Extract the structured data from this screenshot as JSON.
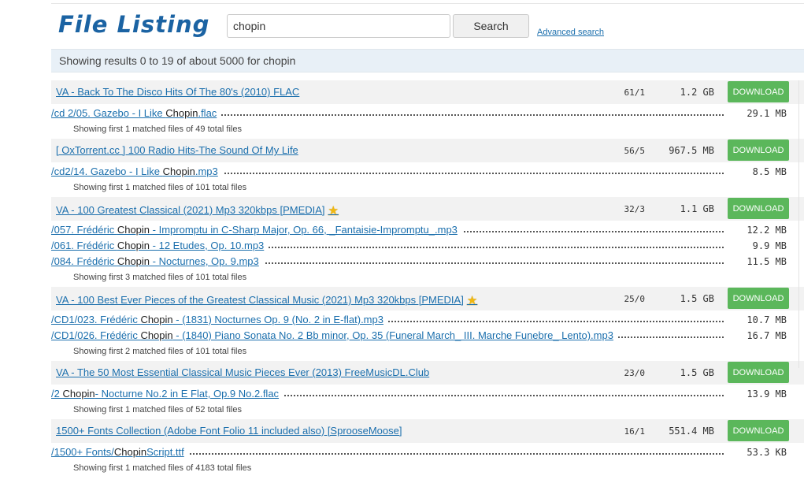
{
  "header": {
    "logo_text": "File Listing",
    "search_value": "chopin",
    "search_button": "Search",
    "advanced_link": "Advanced search"
  },
  "results_text": "Showing results 0 to 19 of about 5000 for chopin",
  "accent_colors": {
    "link": "#1b6fad",
    "download_button": "#5bb75b",
    "logo": "#1b63a3"
  },
  "download_label": "DOWNLOAD",
  "groups": [
    {
      "title": "VA - Back To The Disco Hits Of The 80's (2010) FLAC",
      "starred": false,
      "ratio": "61/1",
      "size": "1.2 GB",
      "files": [
        {
          "pre": "/cd 2/05. Gazebo - I Like ",
          "hl": "Chopin",
          "post": ".flac",
          "size": "29.1 MB"
        }
      ],
      "note": "Showing first 1 matched files of 49 total files"
    },
    {
      "title": "[ OxTorrent.cc ] 100 Radio Hits-The Sound Of My Life",
      "starred": false,
      "ratio": "56/5",
      "size": "967.5 MB",
      "files": [
        {
          "pre": "/cd2/14. Gazebo - I Like ",
          "hl": "Chopin",
          "post": ".mp3",
          "size": "8.5 MB"
        }
      ],
      "note": "Showing first 1 matched files of 101 total files"
    },
    {
      "title": "VA - 100 Greatest Classical (2021) Mp3 320kbps [PMEDIA]",
      "starred": true,
      "ratio": "32/3",
      "size": "1.1 GB",
      "files": [
        {
          "pre": "/057. Frédéric ",
          "hl": "Chopin",
          "post": " - Impromptu in C-Sharp Major, Op. 66, _Fantaisie-Impromptu_.mp3",
          "size": "12.2 MB"
        },
        {
          "pre": "/061. Frédéric ",
          "hl": "Chopin",
          "post": " - 12 Etudes, Op. 10.mp3",
          "size": "9.9 MB"
        },
        {
          "pre": "/084. Frédéric ",
          "hl": "Chopin",
          "post": " - Nocturnes, Op. 9.mp3",
          "size": "11.5 MB"
        }
      ],
      "note": "Showing first 3 matched files of 101 total files"
    },
    {
      "title": "VA - 100 Best Ever Pieces of the Greatest Classical Music (2021) Mp3 320kbps [PMEDIA]",
      "starred": true,
      "ratio": "25/0",
      "size": "1.5 GB",
      "files": [
        {
          "pre": "/CD1/023. Frédéric ",
          "hl": "Chopin",
          "post": " - (1831) Nocturnes Op. 9 (No. 2 in E-flat).mp3",
          "size": "10.7 MB"
        },
        {
          "pre": "/CD1/026. Frédéric ",
          "hl": "Chopin",
          "post": " - (1840) Piano Sonata No. 2 Bb minor, Op. 35 (Funeral March_ III. Marche Funebre_ Lento).mp3",
          "size": "16.7 MB"
        }
      ],
      "note": "Showing first 2 matched files of 101 total files"
    },
    {
      "title": "VA - The 50 Most Essential Classical Music Pieces Ever (2013) FreeMusicDL.Club",
      "starred": false,
      "ratio": "23/0",
      "size": "1.5 GB",
      "files": [
        {
          "pre": "/2 ",
          "hl": "Chopin",
          "post": "- Nocturne No.2 in E Flat, Op.9 No.2.flac",
          "size": "13.9 MB"
        }
      ],
      "note": "Showing first 1 matched files of 52 total files"
    },
    {
      "title": "1500+ Fonts Collection (Adobe Font Folio 11 included also) [SprooseMoose]",
      "starred": false,
      "ratio": "16/1",
      "size": "551.4 MB",
      "files": [
        {
          "pre": "/1500+ Fonts/",
          "hl": "Chopin",
          "post": "Script.ttf",
          "size": "53.3 KB"
        }
      ],
      "note": "Showing first 1 matched files of 4183 total files"
    }
  ]
}
